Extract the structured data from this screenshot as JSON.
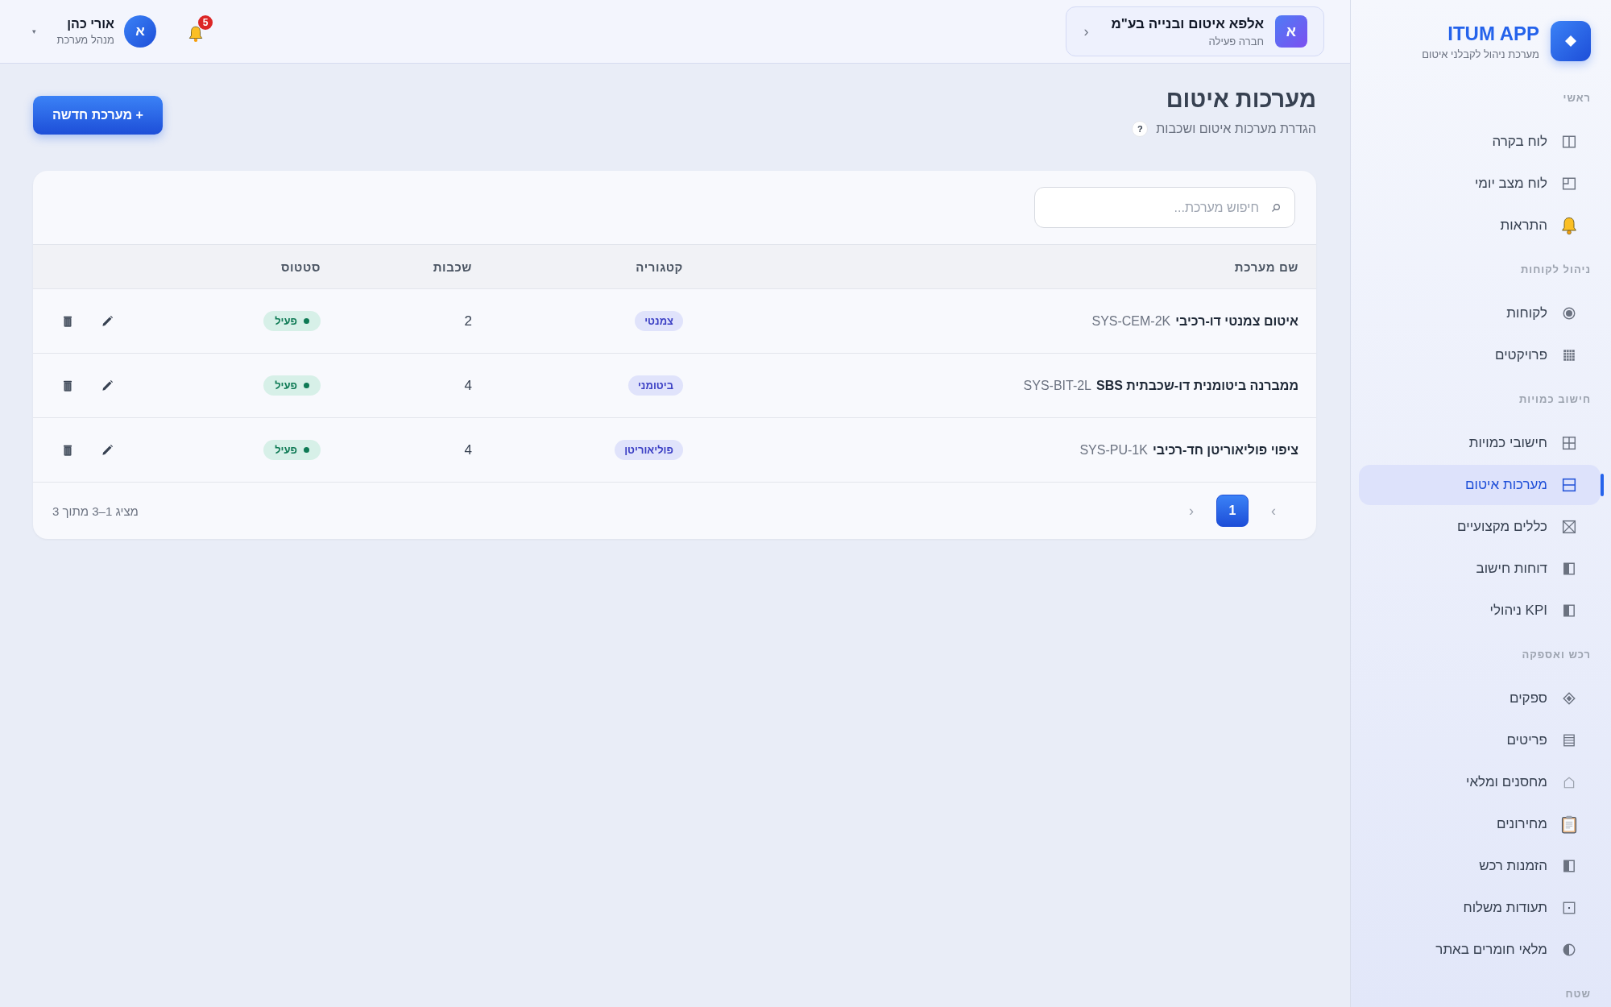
{
  "sidebar": {
    "logo": {
      "title": "ITUM APP",
      "subtitle": "מערכת ניהול לקבלני איטום"
    },
    "sections": [
      {
        "title": "ראשי",
        "items": [
          {
            "label": "לוח בקרה",
            "selected": false
          },
          {
            "label": "לוח מצב יומי",
            "selected": false
          },
          {
            "label": "התראות",
            "selected": false
          }
        ]
      },
      {
        "title": "ניהול לקוחות",
        "items": [
          {
            "label": "לקוחות",
            "selected": false
          },
          {
            "label": "פרויקטים",
            "selected": false
          }
        ]
      },
      {
        "title": "חישוב כמויות",
        "items": [
          {
            "label": "חישובי כמויות",
            "selected": false
          },
          {
            "label": "מערכות איטום",
            "selected": true
          },
          {
            "label": "כללים מקצועיים",
            "selected": false
          },
          {
            "label": "דוחות חישוב",
            "selected": false
          },
          {
            "label": "KPI ניהולי",
            "selected": false
          }
        ]
      },
      {
        "title": "רכש ואספקה",
        "items": [
          {
            "label": "ספקים",
            "selected": false
          },
          {
            "label": "פריטים",
            "selected": false
          },
          {
            "label": "מחסנים ומלאי",
            "selected": false
          },
          {
            "label": "מחירונים",
            "selected": false
          },
          {
            "label": "הזמנות רכש",
            "selected": false
          },
          {
            "label": "תעודות משלוח",
            "selected": false
          },
          {
            "label": "מלאי חומרים באתר",
            "selected": false
          }
        ]
      },
      {
        "title": "שטח"
      }
    ]
  },
  "topbar": {
    "company": {
      "avatar": "א",
      "name": "אלפא איטום ובנייה בע\"מ",
      "status": "חברה פעילה",
      "chevron": "‹"
    },
    "notifications": {
      "count": "5"
    },
    "user": {
      "avatar": "א",
      "name": "אורי כהן",
      "role": "מנהל מערכת",
      "caret": "▾"
    }
  },
  "page": {
    "title": "מערכות איטום",
    "subtitle": "הגדרת מערכות איטום ושכבות",
    "help": "?",
    "new_button": "+ מערכת חדשה"
  },
  "table": {
    "search": {
      "placeholder": "חיפוש מערכת..."
    },
    "columns": [
      "שם מערכת",
      "קטגוריה",
      "שכבות",
      "סטטוס"
    ],
    "rows": [
      {
        "name": "איטום צמנטי דו-רכיבי",
        "code": "SYS-CEM-2K",
        "category": "צמנטי",
        "layers": "2",
        "status": "פעיל",
        "active": true
      },
      {
        "name": "ממברנה ביטומנית דו-שכבתית SBS",
        "code": "SYS-BIT-2L",
        "category": "ביטומני",
        "layers": "4",
        "status": "פעיל",
        "active": true
      },
      {
        "name": "ציפוי פוליאוריטן חד-רכיבי",
        "code": "SYS-PU-1K",
        "category": "פוליאוריטן",
        "layers": "4",
        "status": "פעיל",
        "active": true
      }
    ],
    "footer": {
      "summary": "מציג 1–3 מתוך 3",
      "prev": "›",
      "pages": [
        {
          "label": "1",
          "selected": true
        }
      ],
      "next": "‹"
    }
  }
}
